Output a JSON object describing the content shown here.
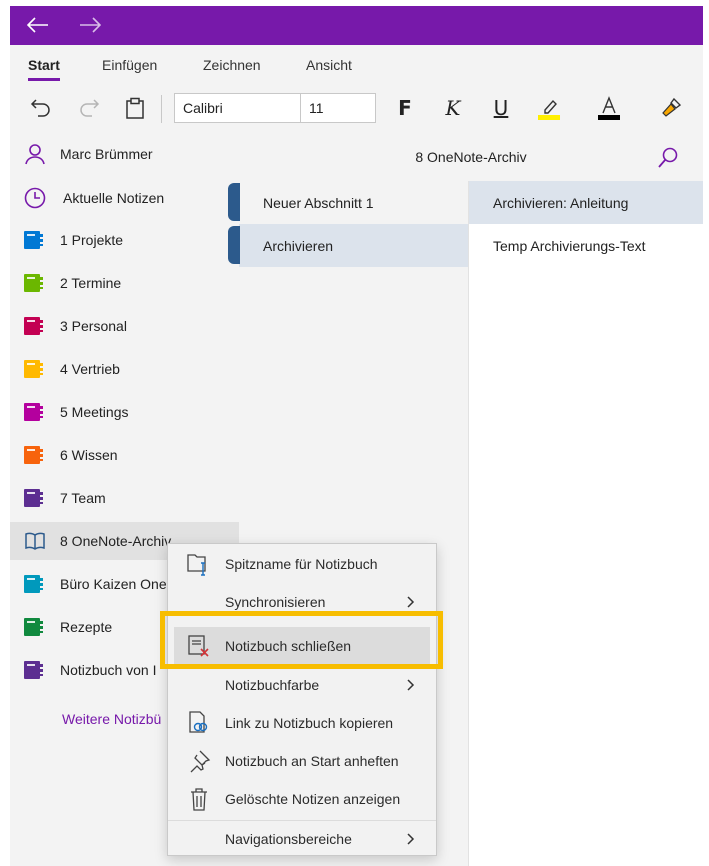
{
  "colors": {
    "accent": "#7719aa",
    "highlight_box": "#f7bd00",
    "section_tab": "#2c5a8c"
  },
  "titlebar": {
    "back_icon": "arrow-left-icon",
    "forward_icon": "arrow-right-icon"
  },
  "ribbon": {
    "tabs": [
      {
        "label": "Start"
      },
      {
        "label": "Einfügen"
      },
      {
        "label": "Zeichnen"
      },
      {
        "label": "Ansicht"
      }
    ],
    "font_name": "Calibri",
    "font_size": "11",
    "bold_label": "F",
    "italic_label": "K",
    "underline_label": "U",
    "highlight_color": "#ffef00",
    "font_color": "#000000"
  },
  "sidebar": {
    "user": "Marc Brümmer",
    "recent": "Aktuelle Notizen",
    "notebooks": [
      {
        "label": "1 Projekte",
        "color": "#0078d4"
      },
      {
        "label": "2 Termine",
        "color": "#6bb700"
      },
      {
        "label": "3 Personal",
        "color": "#c30052"
      },
      {
        "label": "4 Vertrieb",
        "color": "#ffb900"
      },
      {
        "label": "5 Meetings",
        "color": "#b4009e"
      },
      {
        "label": "6 Wissen",
        "color": "#f7630c"
      },
      {
        "label": "7 Team",
        "color": "#5c2e91"
      },
      {
        "label": "8 OneNote-Archiv",
        "color": "#2c5a8c"
      },
      {
        "label": "Büro Kaizen One",
        "color": "#0099bc"
      },
      {
        "label": "Rezepte",
        "color": "#10893e"
      },
      {
        "label": "Notizbuch von I",
        "color": "#5c2e91"
      }
    ],
    "more_link": "Weitere Notizbü"
  },
  "pane": {
    "title": "8 OneNote-Archiv",
    "sections": [
      {
        "label": "Neuer Abschnitt 1"
      },
      {
        "label": "Archivieren"
      }
    ],
    "pages": [
      {
        "label": "Archivieren: Anleitung"
      },
      {
        "label": "Temp Archivierungs-Text"
      }
    ]
  },
  "context_menu": {
    "items": [
      {
        "label": "Spitzname für Notizbuch",
        "icon": "rename-notebook-icon"
      },
      {
        "label": "Synchronisieren",
        "icon": "",
        "submenu": true
      },
      {
        "label": "Notizbuch schließen",
        "icon": "close-notebook-icon"
      },
      {
        "label": "Notizbuchfarbe",
        "icon": "",
        "submenu": true
      },
      {
        "label": "Link zu Notizbuch kopieren",
        "icon": "copy-link-icon"
      },
      {
        "label": "Notizbuch an Start anheften",
        "icon": "pin-icon"
      },
      {
        "label": "Gelöschte Notizen anzeigen",
        "icon": "trash-icon"
      },
      {
        "label": "Navigationsbereiche",
        "icon": "",
        "submenu": true
      }
    ]
  }
}
